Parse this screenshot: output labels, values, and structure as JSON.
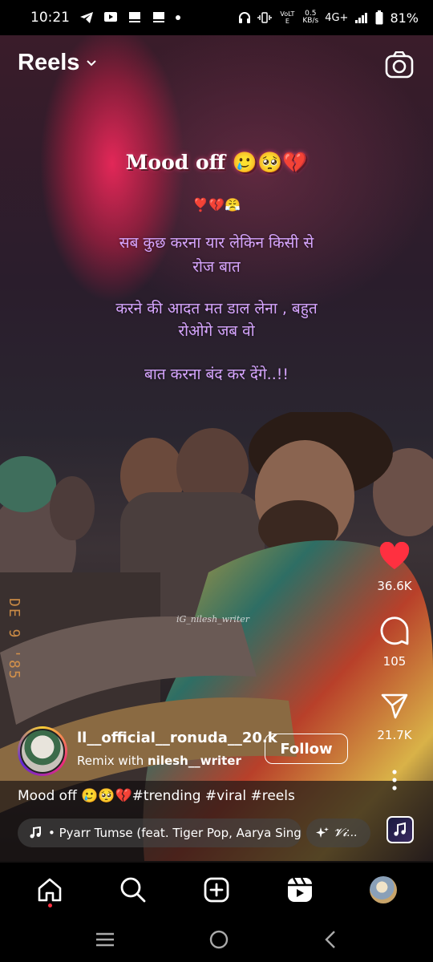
{
  "status_bar": {
    "time": "10:21",
    "network_label": "4G+",
    "data_rate_value": "0.5",
    "data_rate_unit": "KB/s",
    "volte_label": "VoLTE",
    "battery": "81%"
  },
  "header": {
    "title": "Reels"
  },
  "overlay": {
    "title": "Mood off 🥲🥺💔",
    "emoji_line": "❣️💔😤",
    "line1": "सब कुछ करना यार लेकिन किसी से",
    "line2": "रोज बात",
    "line3": "करने की आदत मत डाल लेना , बहुत",
    "line4": "रोओगे जब वो",
    "line5": "बात करना बंद कर देंगे..!!",
    "watermark": "iG_nilesh_writer",
    "date_stamp": "DE 9 '85"
  },
  "actions": {
    "likes": "36.6K",
    "comments": "105",
    "shares": "21.7K"
  },
  "post": {
    "username": "ll__official__ronuda__20.k",
    "remix_prefix": "Remix with ",
    "remix_user": "nilesh__writer",
    "follow_label": "Follow",
    "caption": "Mood off 🥲🥺💔#trending #viral #reels",
    "music": "• Pyarr Tumse (feat. Tiger Pop, Aarya Sing",
    "effect": "𝓥𝓲..."
  },
  "colors": {
    "like_red": "#ff3040",
    "hindi_text": "#d7a6ff"
  },
  "icons": {
    "home": "home-icon",
    "search": "search-icon",
    "create": "plus-square-icon",
    "reels": "reels-icon",
    "camera": "camera-icon"
  }
}
